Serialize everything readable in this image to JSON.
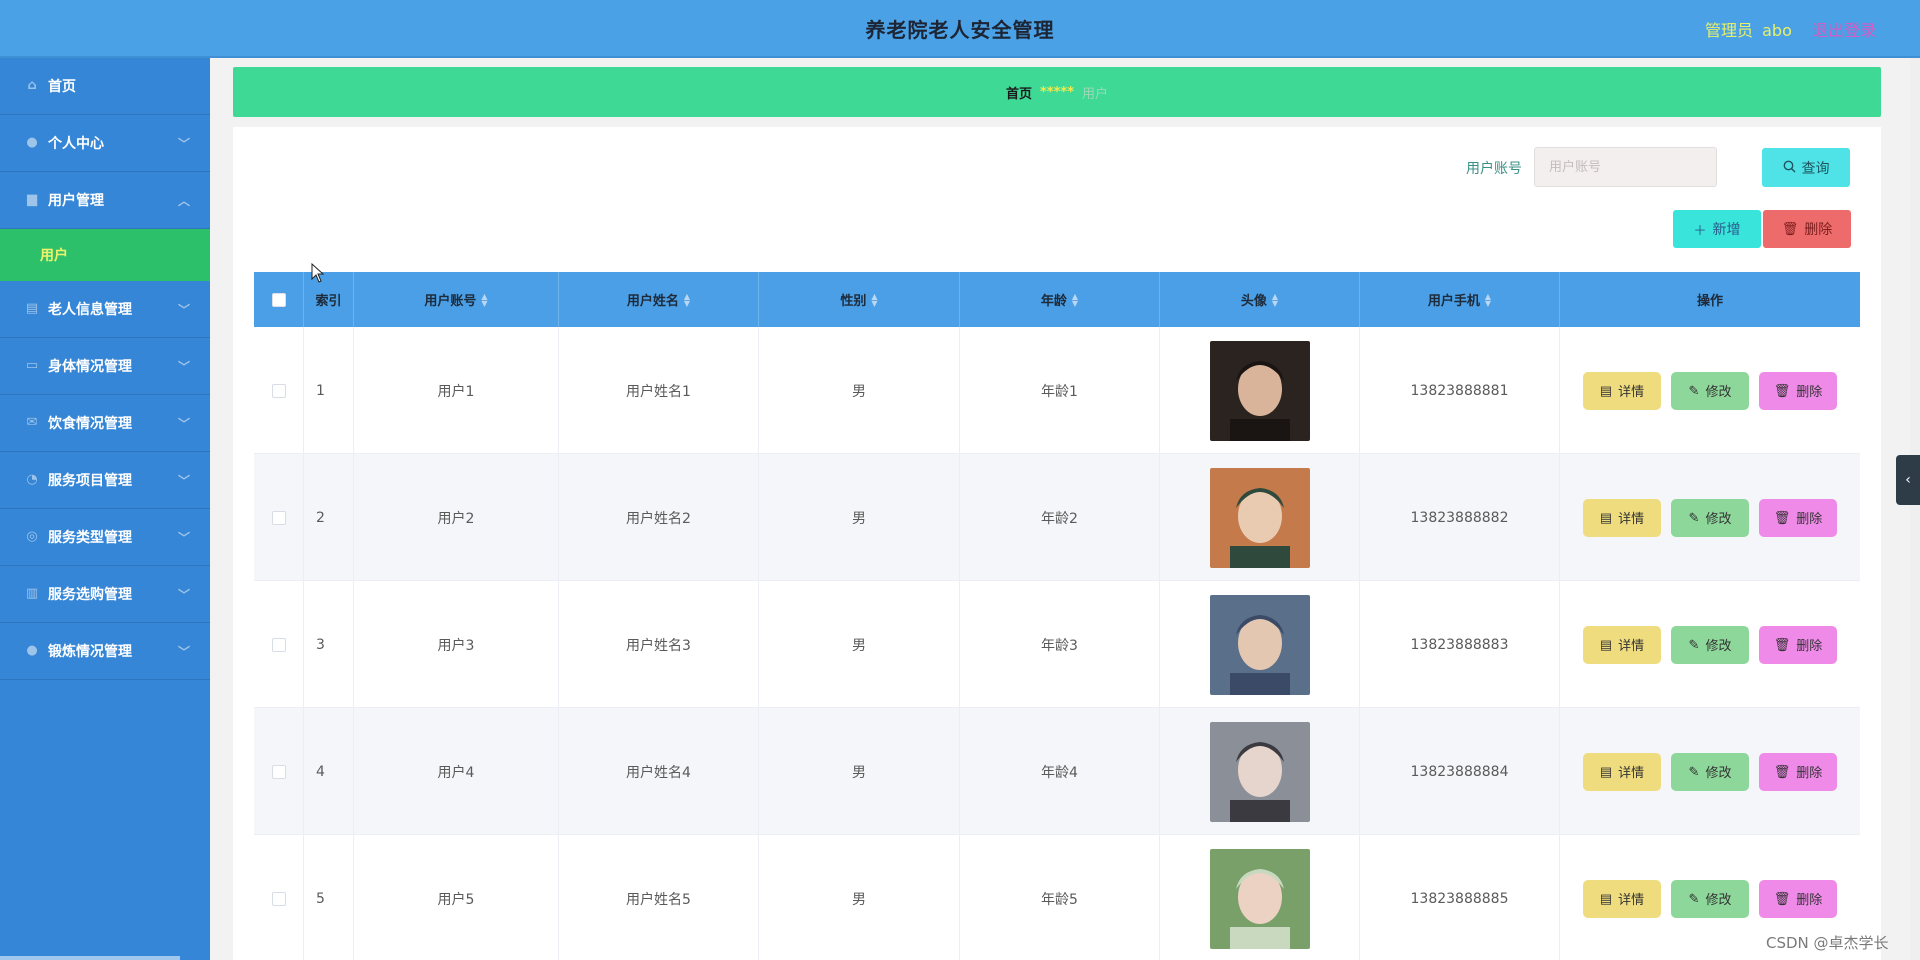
{
  "header": {
    "title": "养老院老人安全管理",
    "admin_label": "管理员",
    "admin_name": "abo",
    "logout": "退出登录"
  },
  "sidebar": {
    "items": [
      {
        "label": "首页",
        "icon": "home-icon"
      },
      {
        "label": "个人中心",
        "icon": "user-icon"
      },
      {
        "label": "用户管理",
        "icon": "folder-icon"
      },
      {
        "label": "用户",
        "icon": ""
      },
      {
        "label": "老人信息管理",
        "icon": "chart-icon"
      },
      {
        "label": "身体情况管理",
        "icon": "chat-icon"
      },
      {
        "label": "饮食情况管理",
        "icon": "mail-icon"
      },
      {
        "label": "服务项目管理",
        "icon": "bell-icon"
      },
      {
        "label": "服务类型管理",
        "icon": "target-icon"
      },
      {
        "label": "服务选购管理",
        "icon": "bars-icon"
      },
      {
        "label": "锻炼情况管理",
        "icon": "location-icon"
      }
    ]
  },
  "breadcrumb": {
    "home": "首页",
    "separator": "*****",
    "current": "用户"
  },
  "search": {
    "label": "用户账号",
    "placeholder": "用户账号",
    "button": "查询"
  },
  "actions": {
    "add": "新增",
    "delete": "删除"
  },
  "table": {
    "headers": [
      "索引",
      "用户账号",
      "用户姓名",
      "性别",
      "年龄",
      "头像",
      "用户手机",
      "操作"
    ],
    "row_actions": {
      "detail": "详情",
      "edit": "修改",
      "remove": "删除"
    },
    "rows": [
      {
        "index": "1",
        "account": "用户1",
        "name": "用户姓名1",
        "gender": "男",
        "age": "年龄1",
        "phone": "13823888881"
      },
      {
        "index": "2",
        "account": "用户2",
        "name": "用户姓名2",
        "gender": "男",
        "age": "年龄2",
        "phone": "13823888882"
      },
      {
        "index": "3",
        "account": "用户3",
        "name": "用户姓名3",
        "gender": "男",
        "age": "年龄3",
        "phone": "13823888883"
      },
      {
        "index": "4",
        "account": "用户4",
        "name": "用户姓名4",
        "gender": "男",
        "age": "年龄4",
        "phone": "13823888884"
      },
      {
        "index": "5",
        "account": "用户5",
        "name": "用户姓名5",
        "gender": "男",
        "age": "年龄5",
        "phone": "13823888885"
      }
    ]
  },
  "watermark": "CSDN @卓杰学长",
  "colors": {
    "header": "#4aa1e6",
    "sidebar": "#3586d6",
    "breadcrumb": "#3fd996",
    "active_sub": "#2dc06a",
    "table_head": "#4a9fe6"
  }
}
